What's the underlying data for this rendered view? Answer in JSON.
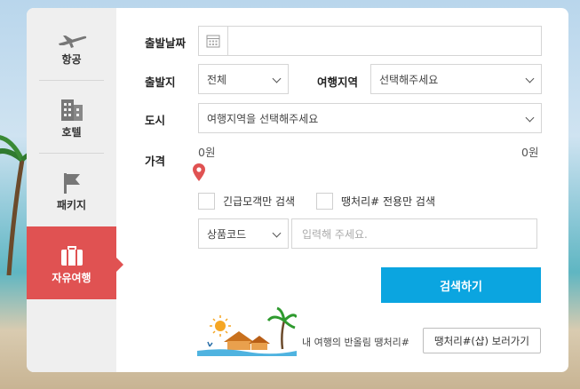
{
  "nav": {
    "tabs": [
      {
        "label": "항공",
        "icon": "airplane-icon"
      },
      {
        "label": "호텔",
        "icon": "building-icon"
      },
      {
        "label": "패키지",
        "icon": "flag-icon"
      },
      {
        "label": "자유여행",
        "icon": "suitcase-icon",
        "active": true
      }
    ]
  },
  "form": {
    "departure_date": {
      "label": "출발날짜",
      "value": ""
    },
    "origin": {
      "label": "출발지",
      "value": "전체"
    },
    "region": {
      "label": "여행지역",
      "value": "선택해주세요"
    },
    "city": {
      "label": "도시",
      "value": "여행지역을 선택해주세요"
    },
    "price": {
      "label": "가격",
      "min": "0원",
      "max": "0원"
    },
    "checkboxes": [
      {
        "label": "긴급모객만 검색",
        "checked": false
      },
      {
        "label": "땡처리# 전용만 검색",
        "checked": false
      }
    ],
    "product_code": {
      "select": "상품코드",
      "placeholder": "입력해 주세요."
    },
    "search_button": "검색하기"
  },
  "promo": {
    "text": "내 여행의 반올림 땡처리#",
    "button": "땡처리#(샵) 보러가기"
  },
  "colors": {
    "accent_red": "#e05252",
    "accent_blue": "#0ba5e0"
  }
}
